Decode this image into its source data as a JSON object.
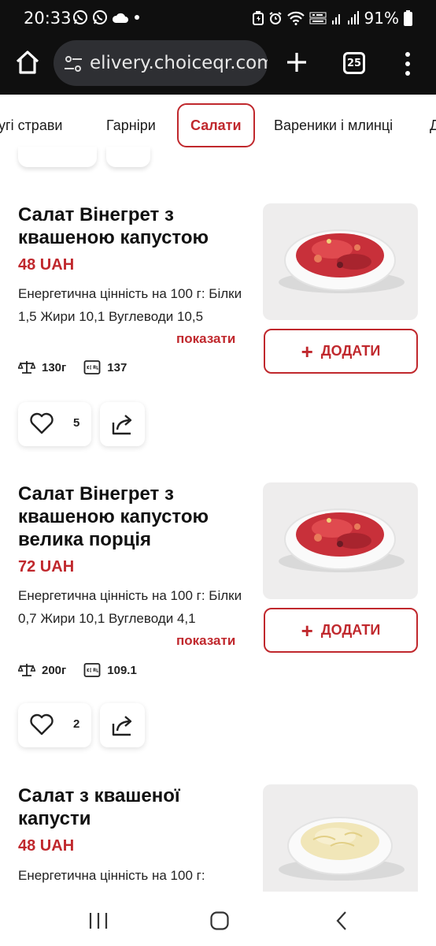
{
  "status": {
    "time": "20:33",
    "battery": "91%"
  },
  "browser": {
    "url": "elivery.choiceqr.com",
    "tab_count": "25"
  },
  "categories": [
    {
      "label": "угі страви"
    },
    {
      "label": "Гарніри"
    },
    {
      "label": "Салати",
      "active": true
    },
    {
      "label": "Вареники і млинці"
    },
    {
      "label": "Д"
    }
  ],
  "products": [
    {
      "title": "Салат Вінегрет з квашеною капустою",
      "price": "48 UAH",
      "energy": "Енергетична цінність на 100 г: Білки 1,5 Жири 10,1 Вуглеводи 10,5",
      "show_label": "показати",
      "weight": "130г",
      "kcal": "137",
      "add_label": "ДОДАТИ",
      "likes": "5",
      "image_icon": "beet-salad-bowl"
    },
    {
      "title": "Салат Вінегрет з квашеною капустою велика порція",
      "price": "72 UAH",
      "energy": "Енергетична цінність на 100 г: Білки 0,7 Жири 10,1 Вуглеводи 4,1",
      "show_label": "показати",
      "weight": "200г",
      "kcal": "109.1",
      "add_label": "ДОДАТИ",
      "likes": "2",
      "image_icon": "beet-salad-bowl"
    },
    {
      "title": "Салат з квашеної капусти",
      "price": "48 UAH",
      "energy": "Енергетична цінність на 100 г:",
      "image_icon": "sauerkraut-bowl"
    }
  ],
  "colors": {
    "accent": "#c0282d",
    "status_bg": "#0f0f0f",
    "url_pill": "#2e2f33"
  },
  "icons": {
    "weight": "scale-icon",
    "kcal": "kcal-icon",
    "like": "heart-icon",
    "share": "share-icon"
  }
}
